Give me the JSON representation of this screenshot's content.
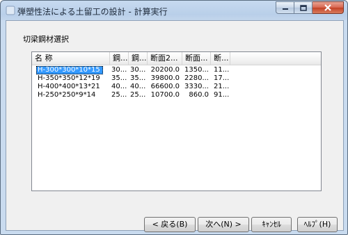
{
  "window": {
    "title": "弾塑性法による土留工の設計 - 計算実行"
  },
  "group": {
    "label": "切梁鋼材選択"
  },
  "listview": {
    "columns": [
      "名 称",
      "鋼...",
      "鋼...",
      "断面2...",
      "断面...",
      "断..."
    ],
    "rows": [
      {
        "cells": [
          "H-300*300*10*15",
          "30...",
          "30...",
          "20200.0",
          "1350...",
          "11..."
        ],
        "selected": true
      },
      {
        "cells": [
          "H-350*350*12*19",
          "35...",
          "35...",
          "39800.0",
          "2280...",
          "17..."
        ],
        "selected": false
      },
      {
        "cells": [
          "H-400*400*13*21",
          "40...",
          "40...",
          "66600.0",
          "3330...",
          "21..."
        ],
        "selected": false
      },
      {
        "cells": [
          "H-250*250*9*14",
          "25...",
          "25...",
          "10700.0",
          "860.0",
          "91..."
        ],
        "selected": false
      }
    ]
  },
  "buttons": {
    "back": "< 戻る(B)",
    "next": "次へ(N) >",
    "cancel": "ｷｬﾝｾﾙ",
    "help": "ﾍﾙﾌﾟ(H)"
  },
  "icons": {
    "minimize": "minimize-icon",
    "maximize": "maximize-icon",
    "close": "close-icon"
  }
}
